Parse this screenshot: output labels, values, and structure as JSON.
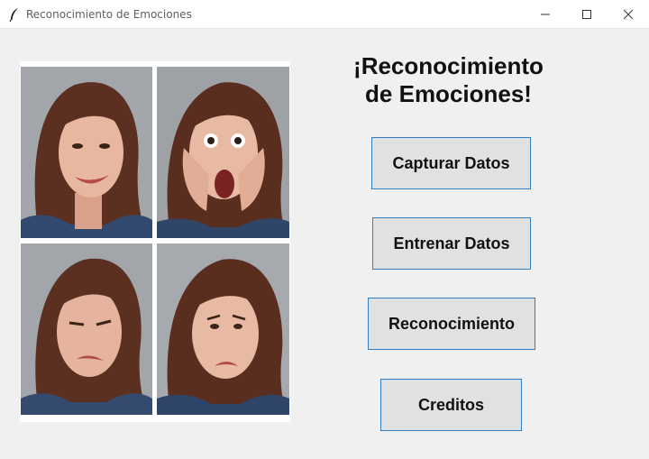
{
  "window": {
    "title": "Reconocimiento de Emociones",
    "icon": "feather-icon"
  },
  "heading": {
    "line1": "¡Reconocimiento",
    "line2": "de Emociones!"
  },
  "buttons": {
    "capturar": "Capturar Datos",
    "entrenar": "Entrenar Datos",
    "reconocimiento": "Reconocimiento",
    "creditos": "Creditos"
  },
  "photos": [
    {
      "expression": "happy"
    },
    {
      "expression": "surprised"
    },
    {
      "expression": "disgusted"
    },
    {
      "expression": "sad"
    }
  ],
  "colors": {
    "background": "#f0f0f0",
    "button_face": "#e1e1e1",
    "button_border": "#2f7fc1"
  }
}
